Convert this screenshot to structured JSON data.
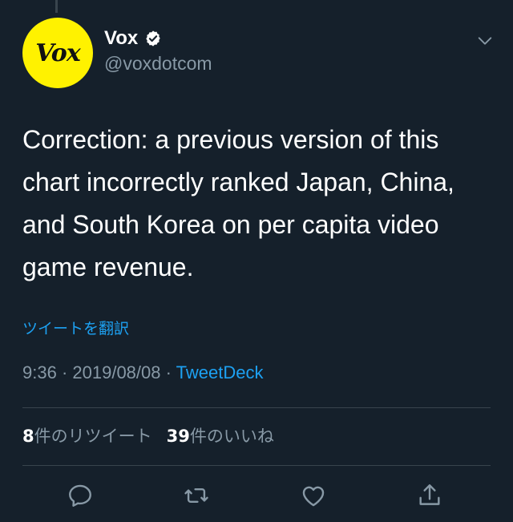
{
  "tweet": {
    "avatar_text": "Vox",
    "display_name": "Vox",
    "handle": "@voxdotcom",
    "text": "Correction: a previous version of this chart incorrectly ranked Japan, China, and South Korea on per capita video game revenue.",
    "translate_label": "ツイートを翻訳",
    "time": "9:36",
    "date": "2019/08/08",
    "separator": " · ",
    "source": "TweetDeck",
    "retweets_count": "8",
    "retweets_label": "件のリツイート",
    "likes_count": "39",
    "likes_label": "件のいいね"
  },
  "colors": {
    "background": "#15202b",
    "accent": "#1da1f2",
    "secondary_text": "#8899a6",
    "divider": "#38444d",
    "avatar_bg": "#fff200"
  },
  "icons": {
    "verified": "verified-badge-icon",
    "menu": "chevron-down-icon",
    "reply": "reply-icon",
    "retweet": "retweet-icon",
    "like": "heart-icon",
    "share": "share-icon"
  }
}
